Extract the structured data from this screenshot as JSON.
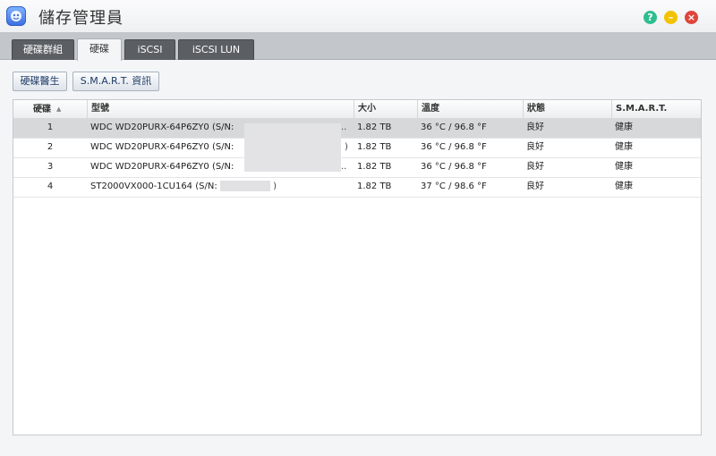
{
  "window": {
    "title": "儲存管理員"
  },
  "tabs": [
    {
      "label": "硬碟群組",
      "active": false
    },
    {
      "label": "硬碟",
      "active": true
    },
    {
      "label": "iSCSI",
      "active": false
    },
    {
      "label": "iSCSI LUN",
      "active": false
    }
  ],
  "toolbar": {
    "doctor_label": "硬碟醫生",
    "smart_label": "S.M.A.R.T. 資訊"
  },
  "grid": {
    "columns": [
      "硬碟",
      "型號",
      "大小",
      "溫度",
      "狀態",
      "S.M.A.R.T."
    ],
    "rows": [
      {
        "disk": "1",
        "model": "WDC WD20PURX-64P6ZY0 (S/N:",
        "model_tail": "..",
        "size": "1.82 TB",
        "temp": "36 °C / 96.8 °F",
        "status": "良好",
        "smart": "健康"
      },
      {
        "disk": "2",
        "model": "WDC WD20PURX-64P6ZY0 (S/N:",
        "model_tail": ")",
        "size": "1.82 TB",
        "temp": "36 °C / 96.8 °F",
        "status": "良好",
        "smart": "健康"
      },
      {
        "disk": "3",
        "model": "WDC WD20PURX-64P6ZY0 (S/N:",
        "model_tail": "..",
        "size": "1.82 TB",
        "temp": "36 °C / 96.8 °F",
        "status": "良好",
        "smart": "健康"
      },
      {
        "disk": "4",
        "model": "ST2000VX000-1CU164 (S/N:",
        "model_tail": ")",
        "size": "1.82 TB",
        "temp": "37 °C / 98.6 °F",
        "status": "良好",
        "smart": "健康"
      }
    ]
  },
  "colors": {
    "help": "#2ebd8f",
    "minimize": "#f3c200",
    "close": "#e0443a",
    "selected_row": "#d7d8da"
  }
}
